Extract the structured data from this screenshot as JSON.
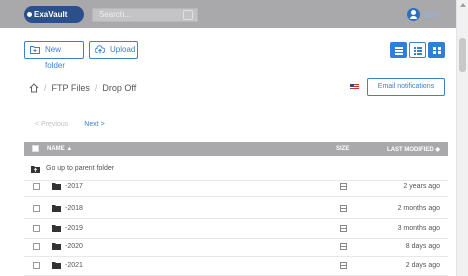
{
  "app": {
    "logo_text": "ExaVault",
    "search_placeholder": "Search...",
    "user_name": "user"
  },
  "toolbar": {
    "new_folder_label": "New folder",
    "upload_label": "Upload"
  },
  "breadcrumb": {
    "items": [
      "FTP Files",
      "Drop Off"
    ]
  },
  "actions": {
    "email_notifications_label": "Email notifications"
  },
  "pager": {
    "previous_label": "< Previous",
    "next_label": "Next >"
  },
  "table": {
    "headers": {
      "name": "NAME ▲",
      "size": "SIZE",
      "modified": "LAST MODIFIED ◆"
    },
    "parent_label": "Go up to parent folder",
    "rows": [
      {
        "name": "-2017",
        "modified": "2 years ago"
      },
      {
        "name": "-2018",
        "modified": "2 months ago"
      },
      {
        "name": "-2019",
        "modified": "3 months ago"
      },
      {
        "name": "-2020",
        "modified": "8 days ago"
      },
      {
        "name": "-2021",
        "modified": "2 days ago"
      }
    ]
  },
  "colors": {
    "accent": "#3f7fd0",
    "topbar": "#a9a9ab",
    "header": "#a9a9ab",
    "logo": "#2a4f8a"
  },
  "icons": {
    "new_folder": "folder-plus-icon",
    "upload": "cloud-upload-icon",
    "home": "home-icon",
    "flag": "us-flag-icon",
    "folder": "folder-icon",
    "size": "storage-icon",
    "parent": "folder-up-icon",
    "user": "user-avatar-icon"
  }
}
